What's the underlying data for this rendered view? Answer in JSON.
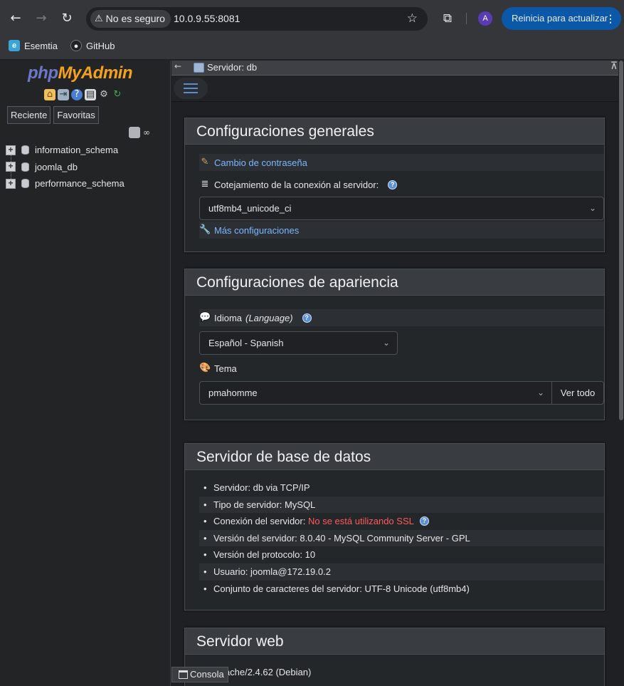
{
  "browser": {
    "security_label": "No es seguro",
    "url": "10.0.9.55:8081",
    "profile_initial": "A",
    "update_label": "Reinicia para actualizar",
    "bookmarks": [
      {
        "label": "Esemtia",
        "icon": "esemtia-favicon"
      },
      {
        "label": "GitHub",
        "icon": "github-icon"
      }
    ]
  },
  "sidebar": {
    "logo_php": "php",
    "logo_my": "My",
    "logo_admin": "Admin",
    "tabs": [
      "Reciente",
      "Favoritas"
    ],
    "databases": [
      "information_schema",
      "joomla_db",
      "performance_schema"
    ]
  },
  "topbar": {
    "server_label": "Servidor: db"
  },
  "general": {
    "title": "Configuraciones generales",
    "change_password": "Cambio de contraseña",
    "collation_label": "Cotejamiento de la conexión al servidor:",
    "collation_value": "utf8mb4_unicode_ci",
    "more_settings": "Más configuraciones"
  },
  "appearance": {
    "title": "Configuraciones de apariencia",
    "language_label": "Idioma",
    "language_label_en": "(Language)",
    "language_value": "Español - Spanish",
    "theme_label": "Tema",
    "theme_value": "pmahomme",
    "view_all": "Ver todo"
  },
  "dbserver": {
    "title": "Servidor de base de datos",
    "server": "Servidor: db via TCP/IP",
    "type": "Tipo de servidor: MySQL",
    "connection_label": "Conexión del servidor:",
    "connection_value": "No se está utilizando SSL",
    "version": "Versión del servidor: 8.0.40 - MySQL Community Server - GPL",
    "protocol": "Versión del protocolo: 10",
    "user": "Usuario: joomla@172.19.0.2",
    "charset": "Conjunto de caracteres del servidor: UTF-8 Unicode (utf8mb4)"
  },
  "webserver": {
    "title": "Servidor web",
    "first_item": "Apache/2.4.62 (Debian)"
  },
  "console_label": "Consola",
  "colors": {
    "accent": "#7ab7ff",
    "warning": "#ff5a5a",
    "update_button": "#0b57a8"
  }
}
